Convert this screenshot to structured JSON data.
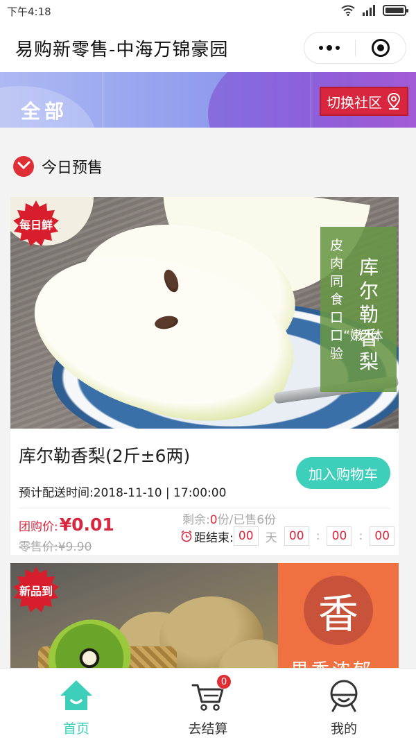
{
  "status_bar": {
    "time": "下午4:18"
  },
  "header": {
    "title": "易购新零售-中海万锦豪园"
  },
  "banner": {
    "all_label": "全部",
    "switch_label": "切换社区"
  },
  "section": {
    "title": "今日预售"
  },
  "products": [
    {
      "badge": "每日鲜",
      "photo_subtitle": "皮肉同食 口口“嫩”体验",
      "photo_name": "库尔勒香梨",
      "name": "库尔勒香梨(2斤±6两)",
      "add_to_cart_label": "加入购物车",
      "delivery": "预计配送时间:2018-11-10 | 17:00:00",
      "group_price_label": "团购价:",
      "price_symbol": "¥",
      "price": "0.01",
      "original_price": "零售价:¥9.90",
      "stock_remaining_label": "剩余:",
      "stock_remaining": "0",
      "stock_sold": "份/已售6份",
      "countdown_label": "距结束:",
      "countdown": {
        "days": "00",
        "day_unit": "天",
        "hours": "00",
        "minutes": "00",
        "seconds": "00"
      }
    },
    {
      "badge": "新品到",
      "photo_char": "香",
      "photo_text": "果香浓郁"
    }
  ],
  "tab_bar": {
    "tabs": [
      {
        "label": "首页",
        "icon": "home-icon",
        "active": true
      },
      {
        "label": "去结算",
        "icon": "cart-icon",
        "badge": "0"
      },
      {
        "label": "我的",
        "icon": "profile-icon"
      }
    ]
  },
  "colors": {
    "accent": "#3dcfb9",
    "price_red": "#d7263d",
    "badge_red": "#e02e35"
  }
}
